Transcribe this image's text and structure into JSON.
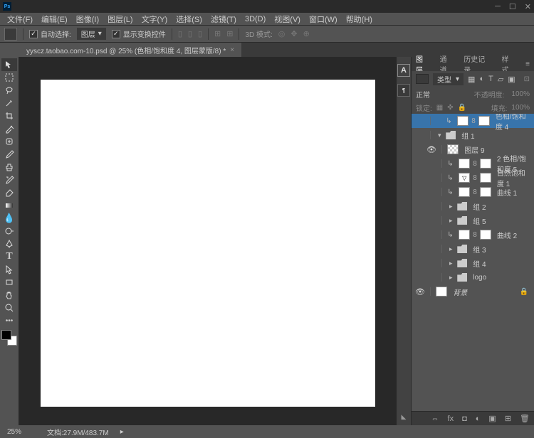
{
  "menus": {
    "file": "文件(F)",
    "edit": "编辑(E)",
    "image": "图像(I)",
    "layer": "图层(L)",
    "type": "文字(Y)",
    "select": "选择(S)",
    "filter": "滤镜(T)",
    "threeD": "3D(D)",
    "view": "视图(V)",
    "window": "窗口(W)",
    "help": "帮助(H)"
  },
  "options": {
    "autoSelect": "自动选择:",
    "target": "图层",
    "showCtrls": "显示变换控件",
    "threeD": "3D 模式:"
  },
  "tab": {
    "title": "yyscz.taobao.com-10.psd @ 25% (色相/饱和度 4, 图层蒙版/8) *"
  },
  "status": {
    "zoom": "25%",
    "doc": "文档:27.9M/483.7M"
  },
  "panel": {
    "tabs": {
      "layers": "图层",
      "channels": "通道",
      "history": "历史记录",
      "paths": "样式"
    },
    "kind": "类型",
    "blend": "正常",
    "opacityLabel": "不透明度:",
    "opacity": "100%",
    "lockLabel": "锁定:",
    "fillLabel": "填充:",
    "fill": "100%"
  },
  "layers": {
    "hueSat4": "色相/饱和度 4",
    "grp1": "组 1",
    "layer9": "图层 9",
    "hueSat5": "2  色相/饱和度 5",
    "vibrance1": "自然饱和度 1",
    "curves1": "曲线 1",
    "grp2": "组 2",
    "grp5": "组 5",
    "curves2": "曲线 2",
    "grp3": "组 3",
    "grp4": "组 4",
    "logo": "logo",
    "bg": "背景"
  }
}
